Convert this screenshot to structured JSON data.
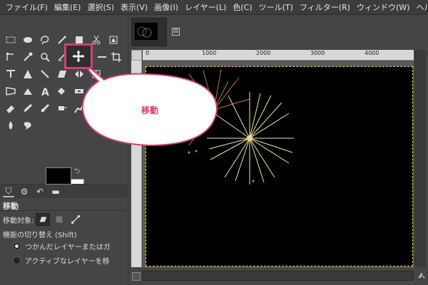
{
  "menubar": {
    "items": [
      "ファイル(F)",
      "編集(E)",
      "選択(S)",
      "表示(V)",
      "画像(I)",
      "レイヤー(L)",
      "色(C)",
      "ツール(T)",
      "フィルター(R)",
      "ウィンドウ(W)",
      "ヘルプ(H)"
    ]
  },
  "toolbox": {
    "active_tool": "move-tool",
    "tools": [
      [
        "rect-select-icon",
        "ellipse-select-icon",
        "free-select-icon",
        "fuzzy-select-icon",
        "scissors-select-icon"
      ],
      [
        "crop-icon",
        "color-picker-icon",
        "zoom-icon",
        "measure-icon",
        "move-icon",
        "align-icon",
        "transform-icon"
      ],
      [
        "text-tool-icon",
        "bucket-fill-icon",
        "gradient-icon",
        "pencil-icon",
        "warp-icon",
        "cage-icon"
      ],
      [
        "perspective-icon",
        "blend-icon",
        "text-a-icon",
        "clone-icon",
        "heal-icon"
      ],
      [
        "eraser-icon",
        "airbrush-icon",
        "ink-icon",
        "mypaint-icon",
        "smudge-icon"
      ],
      [
        "dodge-icon",
        "blur-icon"
      ]
    ],
    "colors": {
      "foreground": "#000000",
      "background": "#ffffff"
    }
  },
  "tool_options": {
    "tabs": [
      "tool-options-tab",
      "device-status-tab",
      "undo-history-tab",
      "images-tab"
    ],
    "title": "移動",
    "target_label": "移動対象:",
    "toggle_label": "機能の切り替え (Shift)",
    "radio_options": [
      {
        "label": "つかんだレイヤーまたはガ",
        "checked": true
      },
      {
        "label": "アクティブなレイヤーを移",
        "checked": false
      }
    ]
  },
  "image_window": {
    "ruler_labels": [
      "0",
      "1000",
      "2000",
      "3000",
      "4000"
    ],
    "close_symbol": "⊠"
  },
  "callout": {
    "text": "移動",
    "color": "#d23f7a"
  }
}
